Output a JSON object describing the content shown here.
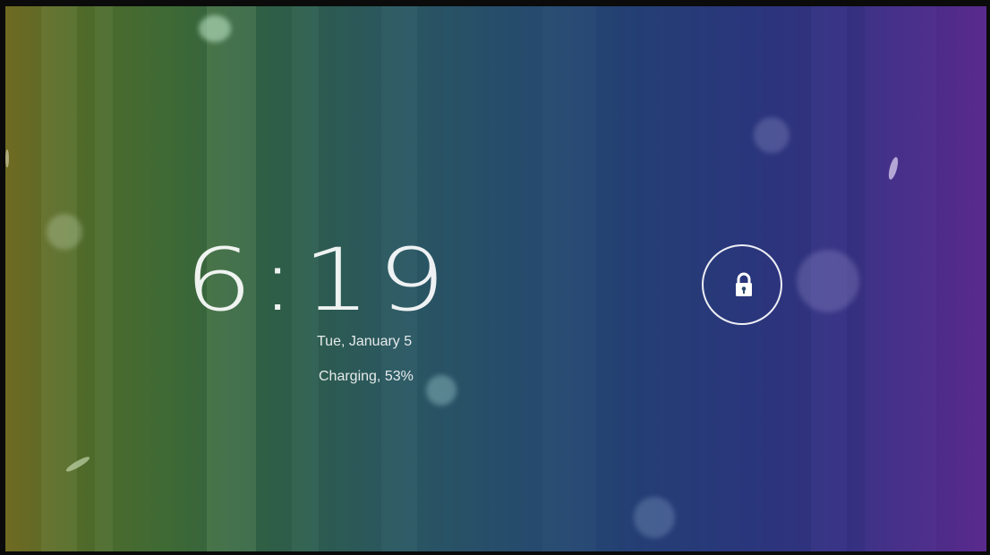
{
  "lockscreen": {
    "time": "6:19",
    "date": "Tue, January 5",
    "battery_status": "Charging, 53%",
    "unlock_icon": "lock-icon"
  },
  "colors": {
    "wallpaper_left": "#6f6a22",
    "wallpaper_mid": "#264c6c",
    "wallpaper_right": "#5a2a8f",
    "text": "#ffffff"
  }
}
